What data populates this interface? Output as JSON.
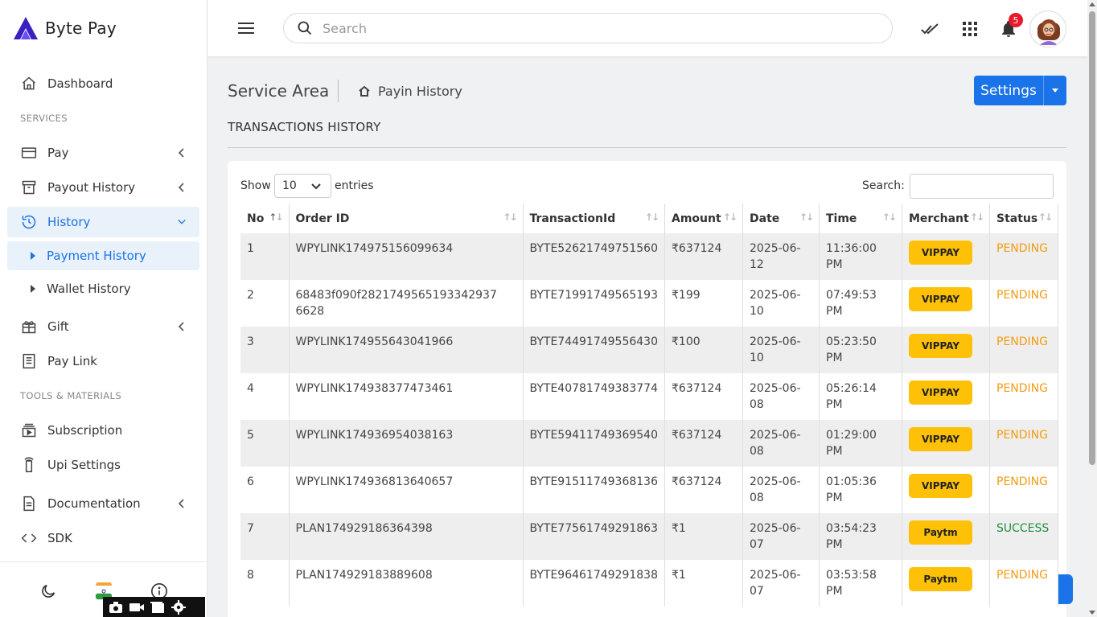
{
  "app": {
    "name": "Byte Pay"
  },
  "sidebar": {
    "dashboard": "Dashboard",
    "services_label": "SERVICES",
    "pay": "Pay",
    "payout_history": "Payout History",
    "history": "History",
    "payment_history": "Payment History",
    "wallet_history": "Wallet History",
    "gift": "Gift",
    "pay_link": "Pay Link",
    "tools_label": "TOOLS & MATERIALS",
    "subscription": "Subscription",
    "upi_settings": "Upi Settings",
    "documentation": "Documentation",
    "sdk": "SDK"
  },
  "header": {
    "search_placeholder": "Search",
    "notification_count": "5"
  },
  "page": {
    "area_title": "Service Area",
    "breadcrumb_page": "Payin History",
    "settings_button": "Settings",
    "section_title": "TRANSACTIONS HISTORY"
  },
  "table_controls": {
    "show_label": "Show",
    "entries_value": "10",
    "entries_label": "entries",
    "search_label": "Search:"
  },
  "table": {
    "columns": [
      "No",
      "Order ID",
      "TransactionId",
      "Amount",
      "Date",
      "Time",
      "Merchant",
      "Status"
    ],
    "rows": [
      {
        "no": "1",
        "order_id": "WPYLINK174975156099634",
        "txn_id": "BYTE52621749751560",
        "amount": "₹637124",
        "date": "2025-06-12",
        "time": "11:36:00 PM",
        "merchant": "VIPPAY",
        "status": "PENDING"
      },
      {
        "no": "2",
        "order_id": "68483f090f2821749565193342937​6628",
        "txn_id": "BYTE71991749565193",
        "amount": "₹199",
        "date": "2025-06-10",
        "time": "07:49:53 PM",
        "merchant": "VIPPAY",
        "status": "PENDING"
      },
      {
        "no": "3",
        "order_id": "WPYLINK174955643041966",
        "txn_id": "BYTE74491749556430",
        "amount": "₹100",
        "date": "2025-06-10",
        "time": "05:23:50 PM",
        "merchant": "VIPPAY",
        "status": "PENDING"
      },
      {
        "no": "4",
        "order_id": "WPYLINK174938377473461",
        "txn_id": "BYTE40781749383774",
        "amount": "₹637124",
        "date": "2025-06-08",
        "time": "05:26:14 PM",
        "merchant": "VIPPAY",
        "status": "PENDING"
      },
      {
        "no": "5",
        "order_id": "WPYLINK174936954038163",
        "txn_id": "BYTE59411749369540",
        "amount": "₹637124",
        "date": "2025-06-08",
        "time": "01:29:00 PM",
        "merchant": "VIPPAY",
        "status": "PENDING"
      },
      {
        "no": "6",
        "order_id": "WPYLINK174936813640657",
        "txn_id": "BYTE91511749368136",
        "amount": "₹637124",
        "date": "2025-06-08",
        "time": "01:05:36 PM",
        "merchant": "VIPPAY",
        "status": "PENDING"
      },
      {
        "no": "7",
        "order_id": "PLAN174929186364398",
        "txn_id": "BYTE77561749291863",
        "amount": "₹1",
        "date": "2025-06-07",
        "time": "03:54:23 PM",
        "merchant": "Paytm",
        "status": "SUCCESS"
      },
      {
        "no": "8",
        "order_id": "PLAN174929183889608",
        "txn_id": "BYTE96461749291838",
        "amount": "₹1",
        "date": "2025-06-07",
        "time": "03:53:58 PM",
        "merchant": "Paytm",
        "status": "PENDING"
      }
    ]
  },
  "colors": {
    "accent": "#1a73e8",
    "merchant_badge": "#ffc107",
    "pending": "#f39c12",
    "success": "#1e8e3e",
    "notification": "#e8192c"
  }
}
